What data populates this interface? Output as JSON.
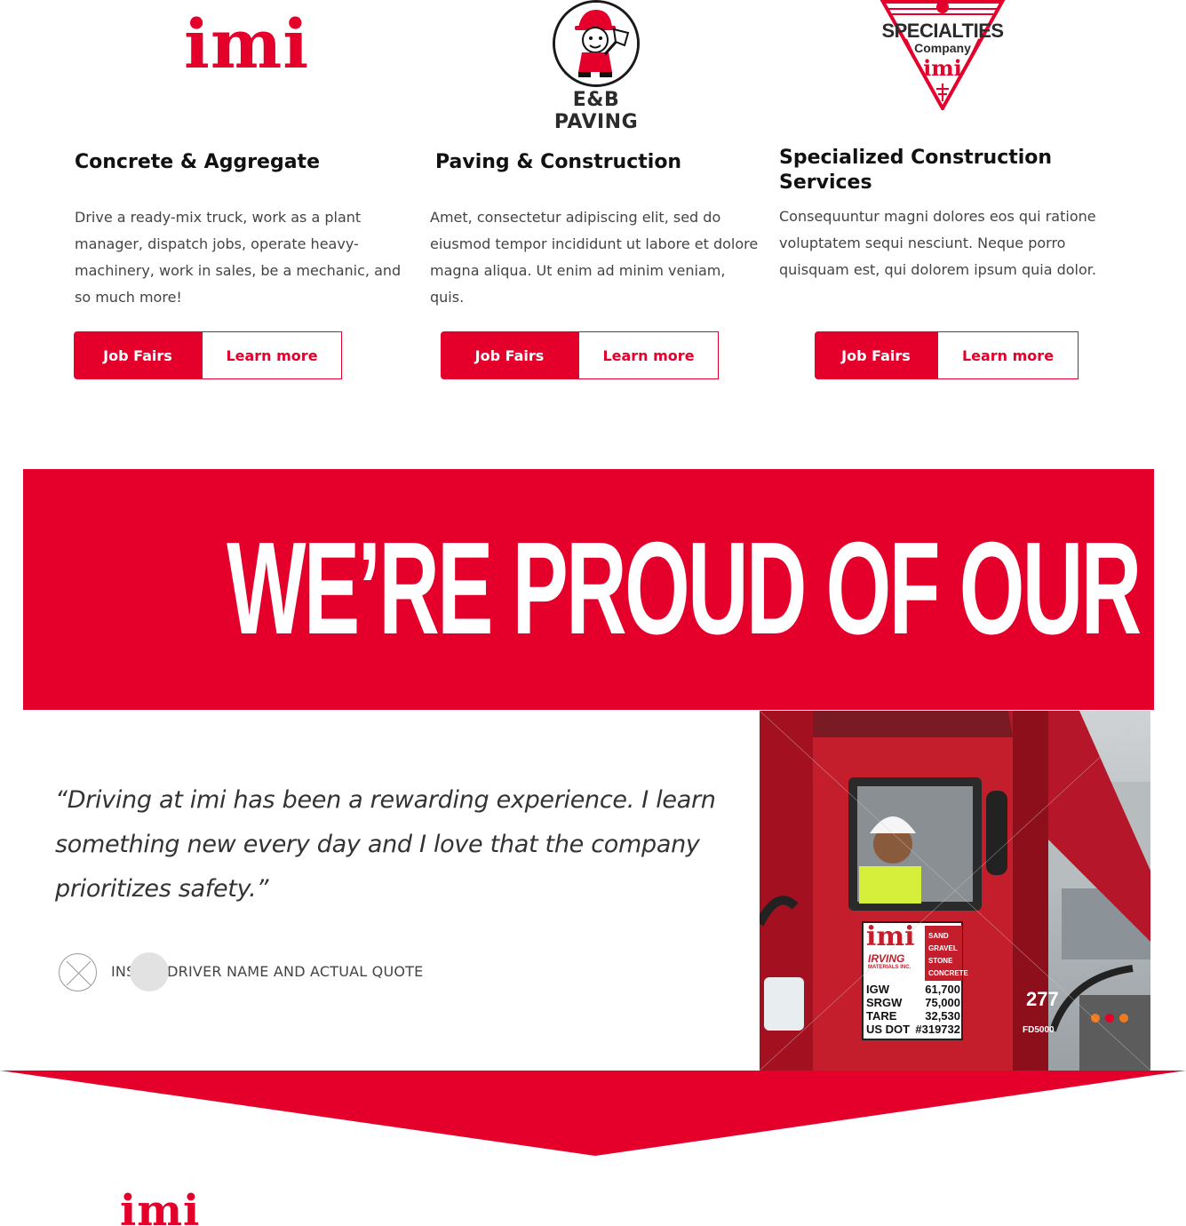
{
  "logos": {
    "imi": "imi",
    "eb_paving": "E&B PAVING",
    "specialties": {
      "line1": "SPECIALTIES",
      "line2": "Company",
      "line3": "imi"
    }
  },
  "services": [
    {
      "title": "Concrete & Aggregate",
      "body": "Drive a ready-mix truck, work as a plant manager, dispatch jobs, operate heavy-machinery, work in sales, be a mechanic, and so much more!",
      "primary_label": "Job Fairs",
      "secondary_label": "Learn more"
    },
    {
      "title": "Paving & Construction",
      "body": "Amet, consectetur adipiscing elit, sed do eiusmod tempor incididunt ut labore et dolore magna aliqua. Ut enim ad minim veniam, quis.",
      "primary_label": "Job Fairs",
      "secondary_label": "Learn more"
    },
    {
      "title": "Specialized Construction Services",
      "body": "Consequuntur magni dolores eos qui ratione voluptatem sequi nesciunt. Neque porro quisquam est, qui dolorem ipsum quia dolor.",
      "primary_label": "Job Fairs",
      "secondary_label": "Learn more"
    }
  ],
  "banner": {
    "title": "WE’RE PROUD OF OUR WORK"
  },
  "testimonial": {
    "quote": "“Driving at imi has been a rewarding experience. I learn something new every day and I love that the company prioritizes safety.”",
    "driver_name": "INSERT DRIVER NAME AND ACTUAL QUOTE"
  },
  "photo": {
    "door_sign": {
      "brand": "imi",
      "company": "IRVING",
      "company_sub": "MATERIALS INC.",
      "products": [
        "SAND",
        "GRAVEL",
        "STONE",
        "CONCRETE"
      ],
      "specs": [
        {
          "label": "IGW",
          "value": "61,700"
        },
        {
          "label": "SRGW",
          "value": "75,000"
        },
        {
          "label": "TARE",
          "value": "32,530"
        },
        {
          "label": "US DOT",
          "value": "#319732"
        }
      ]
    },
    "truck_number": "277",
    "model": "FD5000"
  },
  "footer": {
    "logo": "imi"
  },
  "colors": {
    "brand_red": "#e4002b",
    "text_dark": "#111111",
    "text_body": "#444444"
  }
}
